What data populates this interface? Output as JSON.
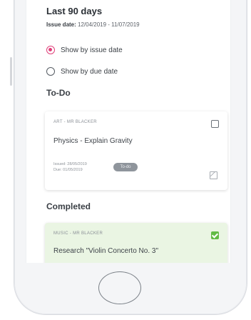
{
  "header": {
    "title": "Last 90 days",
    "issue_label": "Issue date:",
    "issue_range": "12/04/2019 - 11/07/2019"
  },
  "filters": [
    {
      "label": "Show by issue date",
      "selected": true
    },
    {
      "label": "Show by due date",
      "selected": false
    }
  ],
  "todo": {
    "section": "To-Do",
    "card": {
      "subject": "ART - MR BLACKER",
      "title": "Physics - Explain Gravity",
      "issued": "Issued: 28/05/2019",
      "due": "Due: 01/05/2019",
      "status": "To-do",
      "checked": false
    }
  },
  "completed": {
    "section": "Completed",
    "card": {
      "subject": "MUSIC - MR BLACKER",
      "title": "Research \"Violin Concerto No. 3\"",
      "checked": true
    }
  },
  "colors": {
    "accent": "#e0407a",
    "done_bg": "#eaf5e3",
    "check_green": "#62bb46"
  }
}
